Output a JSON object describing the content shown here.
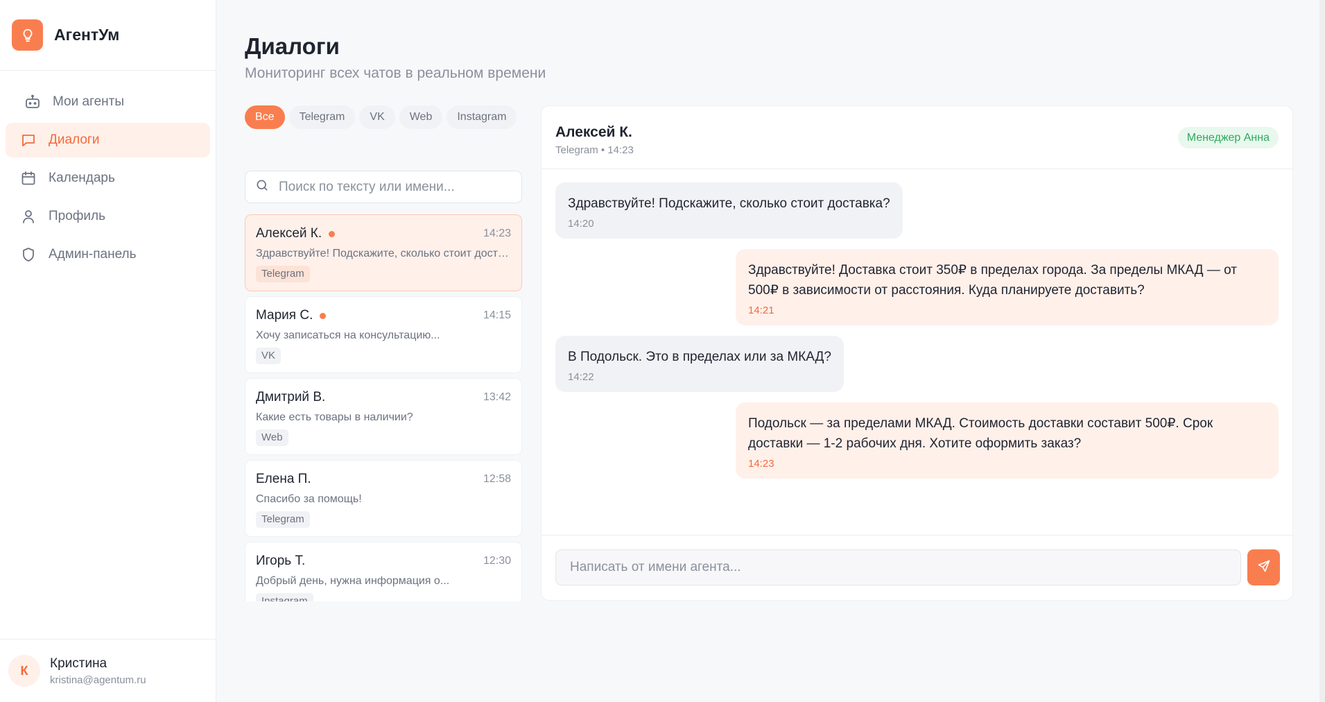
{
  "app": {
    "name": "АгентУм",
    "accent_color": "#f97e4f",
    "logo_icon": "lightbulb-icon"
  },
  "sidebar": {
    "items": [
      {
        "label": "Мои агенты",
        "icon": "robot-icon",
        "active": false
      },
      {
        "label": "Диалоги",
        "icon": "chat-icon",
        "active": true
      },
      {
        "label": "Календарь",
        "icon": "calendar-icon",
        "active": false
      },
      {
        "label": "Профиль",
        "icon": "user-icon",
        "active": false
      },
      {
        "label": "Админ-панель",
        "icon": "shield-icon",
        "active": false
      }
    ],
    "user": {
      "initial": "К",
      "name": "Кристина",
      "email": "kristina@agentum.ru"
    }
  },
  "page": {
    "title": "Диалоги",
    "subtitle": "Мониторинг всех чатов в реальном времени"
  },
  "filters": {
    "chips": [
      "Все",
      "Telegram",
      "VK",
      "Web",
      "Instagram"
    ],
    "selected": "Все"
  },
  "search": {
    "placeholder": "Поиск по тексту или имени...",
    "value": ""
  },
  "dialogs": [
    {
      "name": "Алексей К.",
      "time": "14:23",
      "preview": "Здравствуйте! Подскажите, сколько стоит доставка?",
      "channel": "Telegram",
      "unread": true,
      "active": true
    },
    {
      "name": "Мария С.",
      "time": "14:15",
      "preview": "Хочу записаться на консультацию...",
      "channel": "VK",
      "unread": true,
      "active": false
    },
    {
      "name": "Дмитрий В.",
      "time": "13:42",
      "preview": "Какие есть товары в наличии?",
      "channel": "Web",
      "unread": false,
      "active": false
    },
    {
      "name": "Елена П.",
      "time": "12:58",
      "preview": "Спасибо за помощь!",
      "channel": "Telegram",
      "unread": false,
      "active": false
    },
    {
      "name": "Игорь Т.",
      "time": "12:30",
      "preview": "Добрый день, нужна информация о...",
      "channel": "Instagram",
      "unread": false,
      "active": false
    }
  ],
  "chat": {
    "contact_name": "Алексей К.",
    "meta": "Telegram • 14:23",
    "manager_badge": "Менеджер Анна",
    "messages": [
      {
        "direction": "in",
        "text": "Здравствуйте! Подскажите, сколько стоит доставка?",
        "time": "14:20"
      },
      {
        "direction": "out",
        "text": "Здравствуйте! Доставка стоит 350₽ в пределах города. За пределы МКАД — от 500₽ в зависимости от расстояния. Куда планируете доставить?",
        "time": "14:21"
      },
      {
        "direction": "in",
        "text": "В Подольск. Это в пределах или за МКАД?",
        "time": "14:22"
      },
      {
        "direction": "out",
        "text": "Подольск — за пределами МКАД. Стоимость доставки составит 500₽. Срок доставки — 1-2 рабочих дня. Хотите оформить заказ?",
        "time": "14:23"
      }
    ],
    "composer": {
      "placeholder": "Написать от имени агента...",
      "value": "",
      "send_icon": "send-icon"
    }
  }
}
